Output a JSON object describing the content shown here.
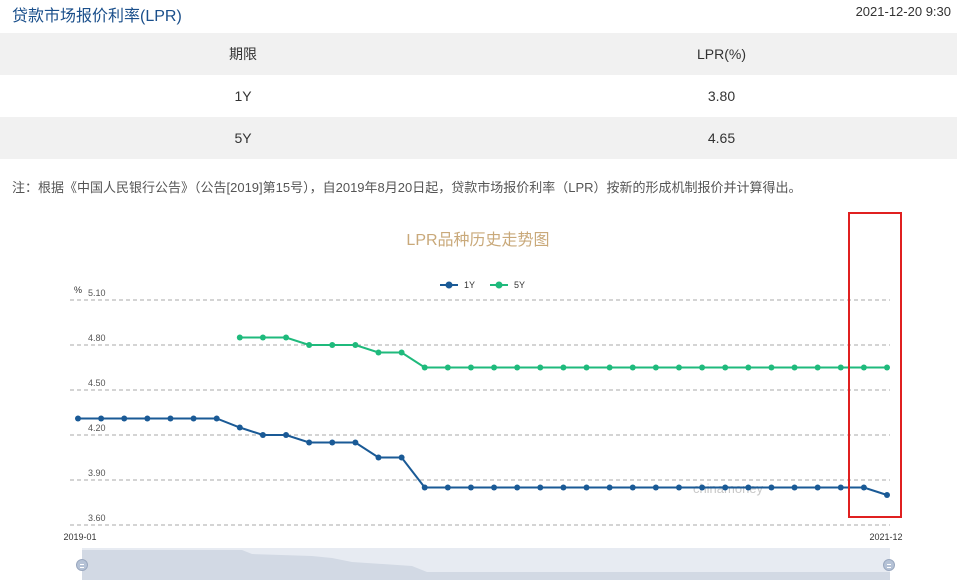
{
  "header": {
    "title": "贷款市场报价利率(LPR)",
    "timestamp": "2021-12-20 9:30"
  },
  "table": {
    "columns": [
      "期限",
      "LPR(%)"
    ],
    "rows": [
      {
        "term": "1Y",
        "rate": "3.80"
      },
      {
        "term": "5Y",
        "rate": "4.65"
      }
    ]
  },
  "note": "注：根据《中国人民银行公告》（公告[2019]第15号），自2019年8月20日起，贷款市场报价利率（LPR）按新的形成机制报价并计算得出。",
  "colors": {
    "series_1y": "#1a5a96",
    "series_5y": "#1fba7c",
    "title": "#c9a97a",
    "highlight": "#e02020"
  },
  "chart_data": {
    "type": "line",
    "title": "LPR品种历史走势图",
    "ylabel": "%",
    "ylim": [
      3.6,
      5.1
    ],
    "yticks": [
      "5.10",
      "4.80",
      "4.50",
      "4.20",
      "3.90",
      "3.60"
    ],
    "x_range_labels": [
      "2019-01",
      "2021-12"
    ],
    "grid": true,
    "legend_position": "top-center",
    "watermark": "chinamoney",
    "points": 36,
    "series": [
      {
        "name": "1Y",
        "start_index": 0,
        "values": [
          4.31,
          4.31,
          4.31,
          4.31,
          4.31,
          4.31,
          4.31,
          4.25,
          4.2,
          4.2,
          4.15,
          4.15,
          4.15,
          4.05,
          4.05,
          3.85,
          3.85,
          3.85,
          3.85,
          3.85,
          3.85,
          3.85,
          3.85,
          3.85,
          3.85,
          3.85,
          3.85,
          3.85,
          3.85,
          3.85,
          3.85,
          3.85,
          3.85,
          3.85,
          3.85,
          3.8
        ]
      },
      {
        "name": "5Y",
        "start_index": 7,
        "values": [
          4.85,
          4.85,
          4.85,
          4.8,
          4.8,
          4.8,
          4.75,
          4.75,
          4.65,
          4.65,
          4.65,
          4.65,
          4.65,
          4.65,
          4.65,
          4.65,
          4.65,
          4.65,
          4.65,
          4.65,
          4.65,
          4.65,
          4.65,
          4.65,
          4.65,
          4.65,
          4.65,
          4.65,
          4.65
        ]
      }
    ]
  }
}
